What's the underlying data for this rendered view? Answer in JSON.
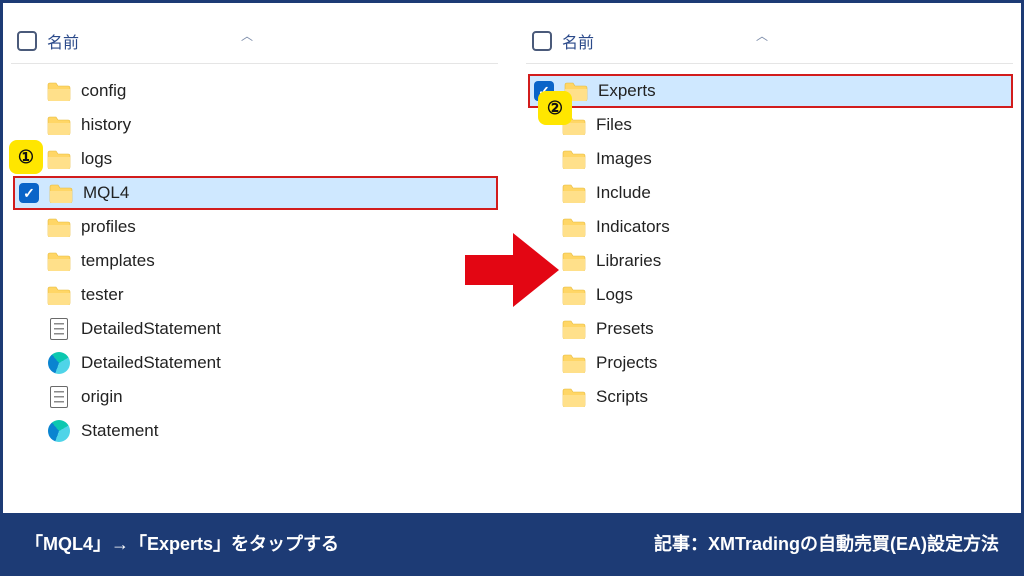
{
  "header": {
    "name_col": "名前"
  },
  "left": {
    "items": [
      {
        "label": "config",
        "type": "folder"
      },
      {
        "label": "history",
        "type": "folder"
      },
      {
        "label": "logs",
        "type": "folder"
      },
      {
        "label": "MQL4",
        "type": "folder",
        "selected": true
      },
      {
        "label": "profiles",
        "type": "folder"
      },
      {
        "label": "templates",
        "type": "folder"
      },
      {
        "label": "tester",
        "type": "folder"
      },
      {
        "label": "DetailedStatement",
        "type": "doc"
      },
      {
        "label": "DetailedStatement",
        "type": "edge"
      },
      {
        "label": "origin",
        "type": "doc"
      },
      {
        "label": "Statement",
        "type": "edge"
      }
    ]
  },
  "right": {
    "items": [
      {
        "label": "Experts",
        "type": "folder",
        "selected": true
      },
      {
        "label": "Files",
        "type": "folder"
      },
      {
        "label": "Images",
        "type": "folder"
      },
      {
        "label": "Include",
        "type": "folder"
      },
      {
        "label": "Indicators",
        "type": "folder"
      },
      {
        "label": "Libraries",
        "type": "folder"
      },
      {
        "label": "Logs",
        "type": "folder"
      },
      {
        "label": "Presets",
        "type": "folder"
      },
      {
        "label": "Projects",
        "type": "folder"
      },
      {
        "label": "Scripts",
        "type": "folder"
      }
    ]
  },
  "badges": {
    "one": "①",
    "two": "②"
  },
  "footer": {
    "left_text": "「MQL4」→「Experts」をタップする",
    "right_text": "記事：XMTradingの自動売買(EA)設定方法"
  },
  "colors": {
    "accent": "#1d3b75",
    "highlight_bg": "#cfe8ff",
    "highlight_border": "#d21c1c",
    "badge_bg": "#ffe600",
    "arrow": "#e30613"
  }
}
